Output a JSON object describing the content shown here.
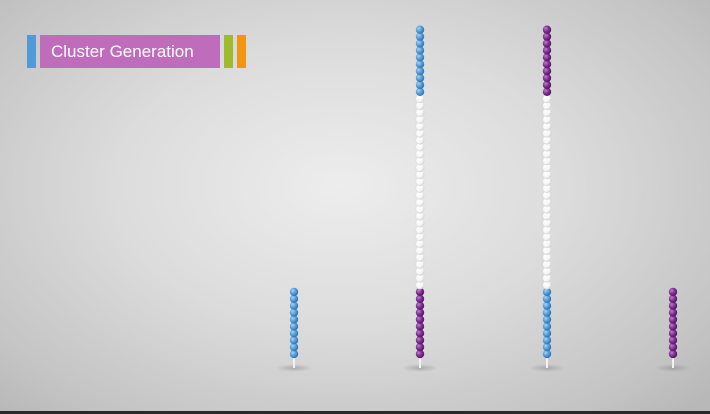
{
  "title": "Cluster Generation",
  "colors": {
    "title_background": "#c06cbd",
    "accent_blue": "#4f9ad8",
    "accent_green": "#9fba2c",
    "accent_orange": "#f2960f",
    "bead_blue": "#4f9ad8",
    "bead_purple": "#7a2d8c",
    "bead_white": "#ffffff"
  },
  "strands": [
    {
      "name": "strand-1",
      "segments": [
        {
          "color": "blue",
          "count": 10
        }
      ]
    },
    {
      "name": "strand-2",
      "segments": [
        {
          "color": "purple",
          "count": 10
        },
        {
          "color": "white",
          "count": 28
        },
        {
          "color": "blue",
          "count": 10
        }
      ]
    },
    {
      "name": "strand-3",
      "segments": [
        {
          "color": "blue",
          "count": 10
        },
        {
          "color": "white",
          "count": 28
        },
        {
          "color": "purple",
          "count": 10
        }
      ]
    },
    {
      "name": "strand-4",
      "segments": [
        {
          "color": "purple",
          "count": 10
        }
      ]
    }
  ]
}
